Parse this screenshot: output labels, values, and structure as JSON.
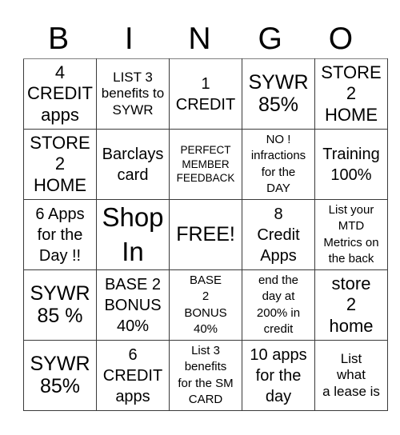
{
  "header": {
    "letters": [
      "B",
      "I",
      "N",
      "G",
      "O"
    ]
  },
  "board": {
    "rows": [
      [
        "4\nCREDIT\napps",
        "LIST 3\nbenefits to\nSYWR",
        "1\nCREDIT",
        "SYWR\n85%",
        "STORE\n2\nHOME"
      ],
      [
        "STORE\n2\nHOME",
        "Barclays\ncard",
        "PERFECT\nMEMBER\nFEEDBACK",
        "NO !\ninfractions\nfor the\nDAY",
        "Training\n100%"
      ],
      [
        "6 Apps\nfor the\nDay !!",
        "Shop\nIn",
        "FREE!",
        "8\nCredit\nApps",
        "List your\nMTD\nMetrics on\nthe back"
      ],
      [
        "SYWR\n85 %",
        "BASE 2\nBONUS\n40%",
        "BASE\n2\nBONUS\n40%",
        "end the\nday at\n200% in\ncredit",
        "store\n2\nhome"
      ],
      [
        "SYWR\n85%",
        "6\nCREDIT\napps",
        "List 3\nbenefits\nfor the SM\nCARD",
        "10 apps\nfor the\nday",
        "List\nwhat\na lease is"
      ]
    ],
    "free_space": "FREE!"
  }
}
